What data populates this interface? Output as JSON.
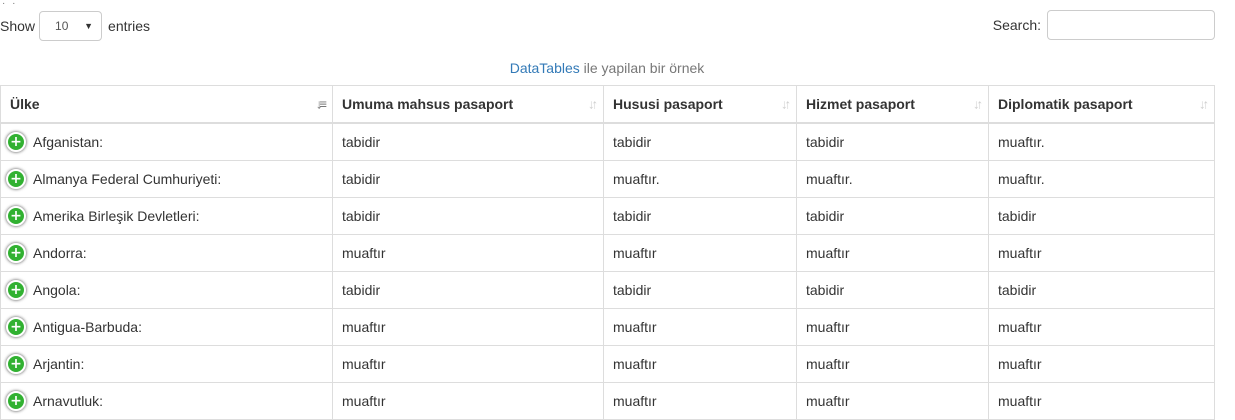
{
  "length": {
    "show_label": "Show",
    "value": "10",
    "entries_label": "entries"
  },
  "search": {
    "label": "Search:",
    "value": ""
  },
  "caption": {
    "link": "DataTables",
    "text": " ile yapilan bir örnek"
  },
  "columns": [
    "Ülke",
    "Umuma mahsus pasaport",
    "Hususi pasaport",
    "Hizmet pasaport",
    "Diplomatik pasaport"
  ],
  "rows": [
    [
      "Afganistan:",
      "tabidir",
      "tabidir",
      "tabidir",
      "muaftır."
    ],
    [
      "Almanya Federal Cumhuriyeti:",
      "tabidir",
      "muaftır.",
      "muaftır.",
      "muaftır."
    ],
    [
      "Amerika Birleşik Devletleri:",
      "tabidir",
      "tabidir",
      "tabidir",
      "tabidir"
    ],
    [
      "Andorra:",
      "muaftır",
      "muaftır",
      "muaftır",
      "muaftır"
    ],
    [
      "Angola:",
      "tabidir",
      "tabidir",
      "tabidir",
      "tabidir"
    ],
    [
      "Antigua-Barbuda:",
      "muaftır",
      "muaftır",
      "muaftır",
      "muaftır"
    ],
    [
      "Arjantin:",
      "muaftır",
      "muaftır",
      "muaftır",
      "muaftır"
    ],
    [
      "Arnavutluk:",
      "muaftır",
      "muaftır",
      "muaftır",
      "muaftır"
    ]
  ],
  "icons": {
    "expand": "plus-circle-icon",
    "sort_active": "sort-ascending-icon",
    "sort": "sort-both-icon"
  }
}
